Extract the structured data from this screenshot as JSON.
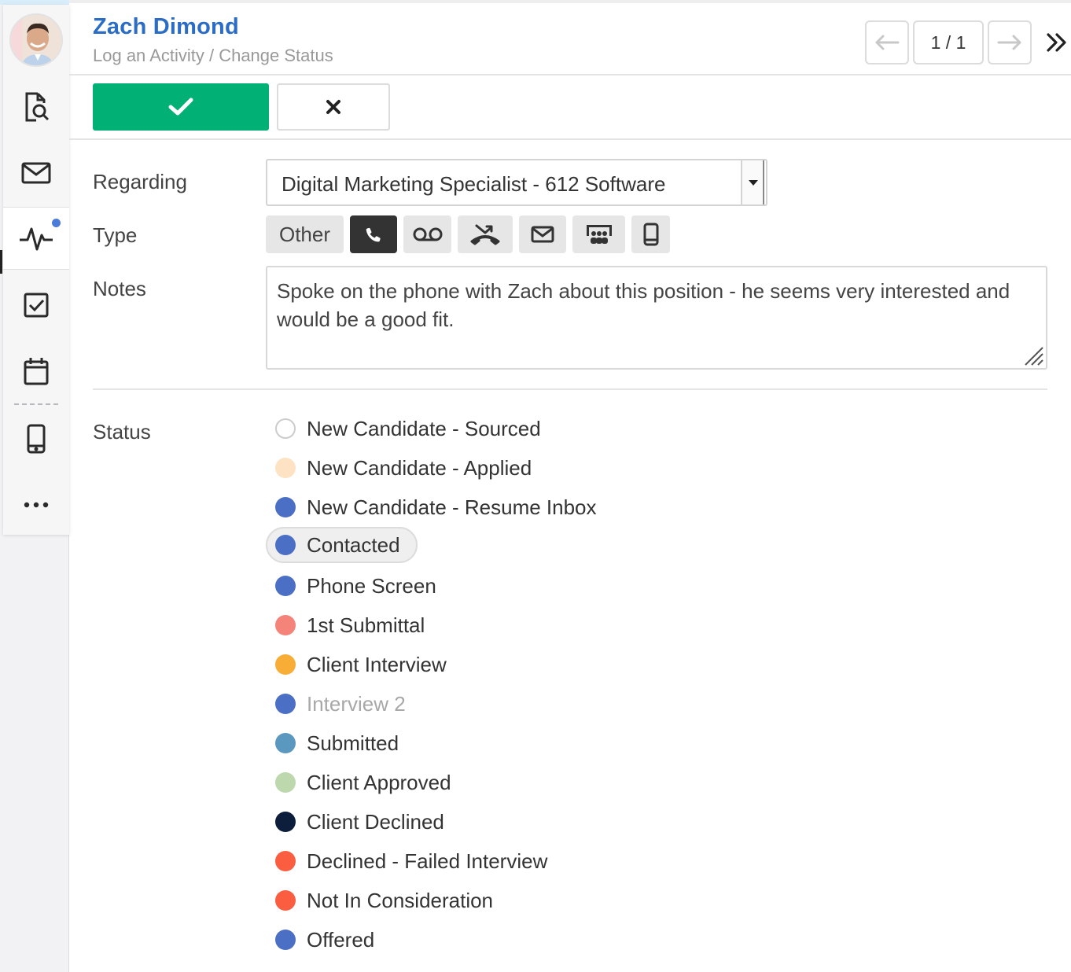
{
  "header": {
    "name": "Zach Dimond",
    "subtitle": "Log an Activity / Change Status",
    "pager": "1 / 1"
  },
  "sidebar": {
    "items": [
      {
        "name": "search-document-icon"
      },
      {
        "name": "mail-icon"
      },
      {
        "name": "activity-icon",
        "active": true,
        "badge": true
      },
      {
        "name": "task-check-icon"
      },
      {
        "name": "calendar-icon"
      },
      {
        "name": "mobile-icon"
      },
      {
        "name": "more-icon"
      }
    ]
  },
  "form": {
    "regarding_label": "Regarding",
    "regarding_value": "Digital Marketing Specialist - 612 Software",
    "type_label": "Type",
    "type_other": "Other",
    "type_icons": [
      "phone-icon",
      "voicemail-icon",
      "missed-call-icon",
      "email-icon",
      "meeting-icon",
      "mobile-icon"
    ],
    "type_selected": "phone-icon",
    "notes_label": "Notes",
    "notes_value": "Spoke on the phone with Zach about this position - he seems very interested and would be a good fit.",
    "status_label": "Status"
  },
  "statuses": [
    {
      "label": "New Candidate - Sourced",
      "color": "#ffffff",
      "border": "#cccccc"
    },
    {
      "label": "New Candidate - Applied",
      "color": "#fde3c4"
    },
    {
      "label": "New Candidate - Resume Inbox",
      "color": "#4a6fc4"
    },
    {
      "label": "Contacted",
      "color": "#4a6fc4",
      "selected": true
    },
    {
      "label": "Phone Screen",
      "color": "#4a6fc4"
    },
    {
      "label": "1st Submittal",
      "color": "#f4837a"
    },
    {
      "label": "Client Interview",
      "color": "#f7ad36"
    },
    {
      "label": "Interview 2",
      "color": "#4a6fc4",
      "disabled": true
    },
    {
      "label": "Submitted",
      "color": "#5b98bf"
    },
    {
      "label": "Client Approved",
      "color": "#bdd8ad"
    },
    {
      "label": "Client Declined",
      "color": "#0d1e3c"
    },
    {
      "label": "Declined - Failed Interview",
      "color": "#fa5d40"
    },
    {
      "label": "Not In Consideration",
      "color": "#fa5d40"
    },
    {
      "label": "Offered",
      "color": "#4a6fc4"
    }
  ],
  "colors": {
    "accent_blue": "#2b6cc4",
    "save_green": "#00b074",
    "selected_type": "#333333"
  }
}
